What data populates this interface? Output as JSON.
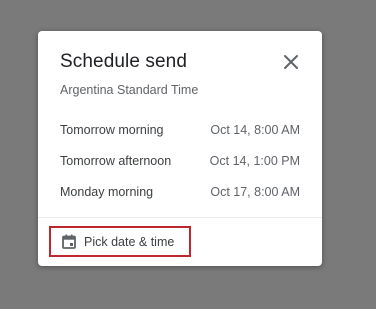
{
  "dialog": {
    "title": "Schedule send",
    "timezone": "Argentina Standard Time",
    "close_icon": "close-icon",
    "options": [
      {
        "label": "Tomorrow morning",
        "when": "Oct 14, 8:00 AM"
      },
      {
        "label": "Tomorrow afternoon",
        "when": "Oct 14, 1:00 PM"
      },
      {
        "label": "Monday morning",
        "when": "Oct 17, 8:00 AM"
      }
    ],
    "pick": {
      "label": "Pick date & time",
      "icon": "calendar-icon"
    }
  },
  "colors": {
    "backdrop": "#7a7a7a",
    "highlight_border": "#c0272d"
  }
}
